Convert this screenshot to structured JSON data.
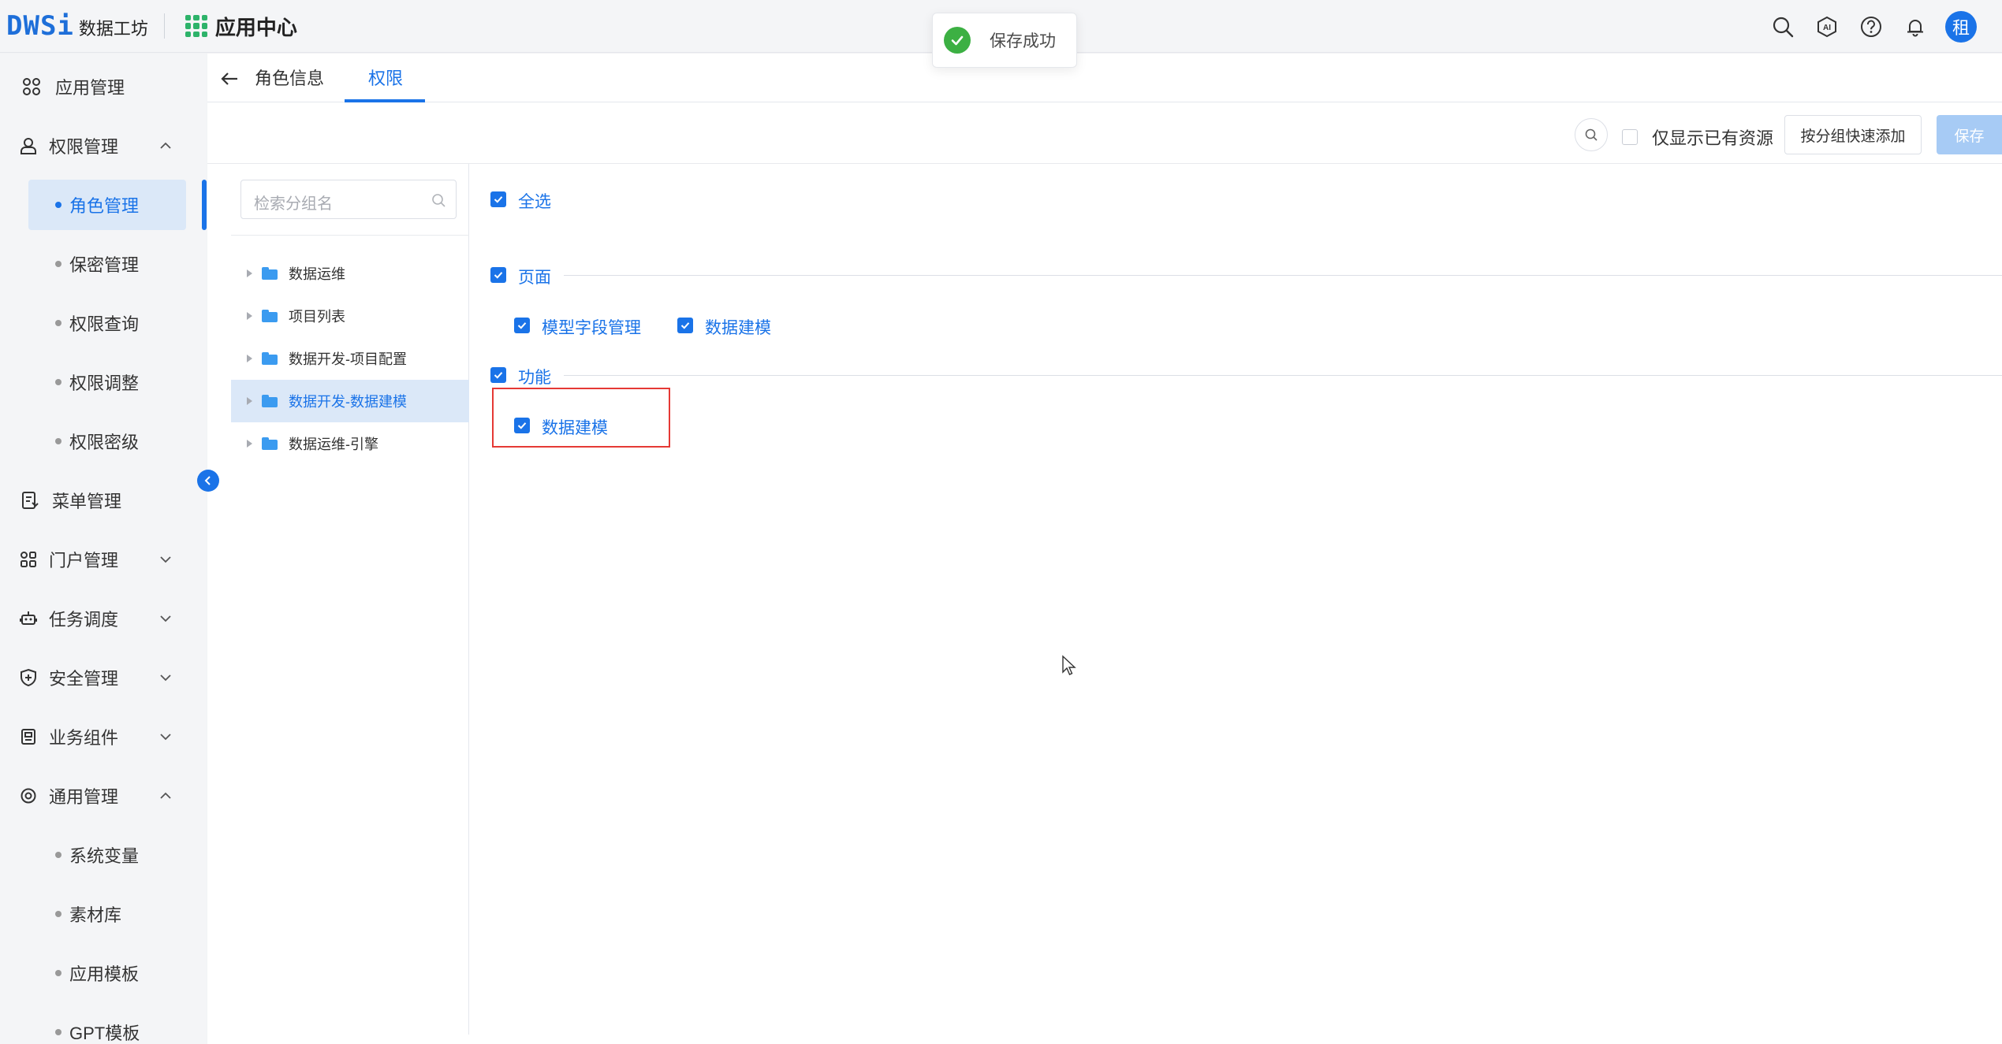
{
  "header": {
    "logo_mark": "DWSi",
    "logo_text": "数据工坊",
    "app_title": "应用中心",
    "icons": [
      "search-icon",
      "ai-icon",
      "help-icon",
      "bell-icon"
    ],
    "avatar_text": "租"
  },
  "toast": {
    "text": "保存成功",
    "icon": "success-check-icon",
    "color": "#3cb043"
  },
  "sidebar": {
    "items": [
      {
        "label": "应用管理",
        "icon": "apps-icon"
      },
      {
        "label": "权限管理",
        "icon": "user-icon",
        "expanded": true
      },
      {
        "label": "菜单管理",
        "icon": "menu-doc-icon"
      },
      {
        "label": "门户管理",
        "icon": "portal-icon",
        "expanded": false
      },
      {
        "label": "任务调度",
        "icon": "robot-icon",
        "expanded": false
      },
      {
        "label": "安全管理",
        "icon": "shield-icon",
        "expanded": false
      },
      {
        "label": "业务组件",
        "icon": "component-icon",
        "expanded": false
      },
      {
        "label": "通用管理",
        "icon": "settings-icon",
        "expanded": true
      }
    ],
    "permission_children": [
      {
        "label": "角色管理",
        "active": true
      },
      {
        "label": "保密管理"
      },
      {
        "label": "权限查询"
      },
      {
        "label": "权限调整"
      },
      {
        "label": "权限密级"
      }
    ],
    "general_children": [
      {
        "label": "系统变量"
      },
      {
        "label": "素材库"
      },
      {
        "label": "应用模板"
      },
      {
        "label": "GPT模板"
      }
    ]
  },
  "tabs": [
    {
      "label": "角色信息",
      "active": false
    },
    {
      "label": "权限",
      "active": true
    }
  ],
  "toolbar": {
    "only_existing_label": "仅显示已有资源",
    "only_existing_checked": false,
    "quick_add_label": "按分组快速添加",
    "save_label": "保存"
  },
  "tree": {
    "search_placeholder": "检索分组名",
    "nodes": [
      {
        "label": "数据运维",
        "selected": false
      },
      {
        "label": "项目列表",
        "selected": false
      },
      {
        "label": "数据开发-项目配置",
        "selected": false
      },
      {
        "label": "数据开发-数据建模",
        "selected": true
      },
      {
        "label": "数据运维-引擎",
        "selected": false
      }
    ]
  },
  "permissions": {
    "select_all": {
      "label": "全选",
      "checked": true
    },
    "page_section": {
      "label": "页面",
      "checked": true,
      "items": [
        {
          "label": "模型字段管理",
          "checked": true
        },
        {
          "label": "数据建模",
          "checked": true
        }
      ]
    },
    "function_section": {
      "label": "功能",
      "checked": true,
      "items": [
        {
          "label": "数据建模",
          "checked": true
        }
      ]
    }
  },
  "colors": {
    "accent": "#1a73e8",
    "highlight_border": "#e53935",
    "success": "#3cb043"
  }
}
